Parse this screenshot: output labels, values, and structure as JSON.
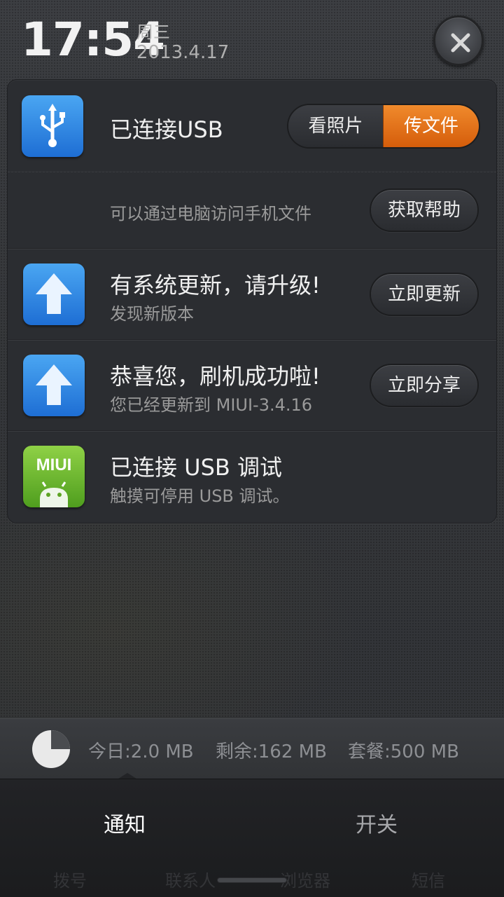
{
  "header": {
    "time": "17:54",
    "weekday": "周三",
    "date": "2013.4.17"
  },
  "notifications": {
    "usb": {
      "title": "已连接USB",
      "segment_left": "看照片",
      "segment_right": "传文件",
      "description": "可以通过电脑访问手机文件",
      "help_button": "获取帮助",
      "icon": "usb-icon"
    },
    "update": {
      "title": "有系统更新，请升级!",
      "subtitle": "发现新版本",
      "button": "立即更新",
      "icon": "upload-arrow-icon"
    },
    "flash": {
      "title": "恭喜您，刷机成功啦!",
      "subtitle": "您已经更新到 MIUI-3.4.16",
      "button": "立即分享",
      "icon": "upload-arrow-icon"
    },
    "debug": {
      "title": "已连接 USB 调试",
      "subtitle": "触摸可停用 USB 调试。",
      "icon_text": "MIUI",
      "icon": "miui-android-icon"
    }
  },
  "usage": {
    "today": "今日:2.0 MB",
    "remaining": "剩余:162 MB",
    "plan": "套餐:500 MB",
    "used_fraction": 0.25
  },
  "tabs": {
    "notify": "通知",
    "switches": "开关"
  },
  "dock_behind": [
    "拨号",
    "联系人",
    "浏览器",
    "短信"
  ],
  "colors": {
    "accent_orange": "#e2701a",
    "icon_blue": "#2f86e6",
    "icon_green": "#6cb52e"
  }
}
